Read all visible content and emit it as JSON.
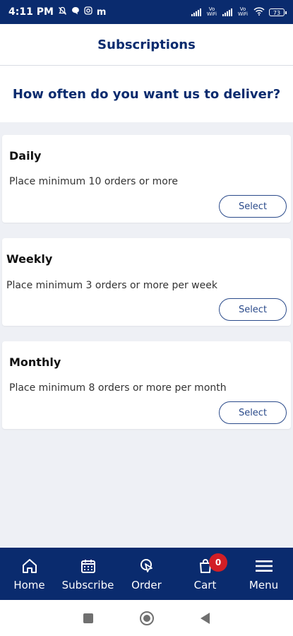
{
  "status_bar": {
    "time": "4:11 PM",
    "icons": [
      "mute-icon",
      "chat-bubble-icon",
      "instagram-icon",
      "messenger-m-icon"
    ],
    "left_extra": "m",
    "vo_wifi_1": "Vo WiFi",
    "vo_wifi_2": "Vo WiFi",
    "battery": "73"
  },
  "header": {
    "title": "Subscriptions"
  },
  "question": {
    "text": "How often do you want us to deliver?"
  },
  "cards": [
    {
      "title": "Daily",
      "description": "Place minimum 10 orders or more",
      "button": "Select"
    },
    {
      "title": "Weekly",
      "description": "Place minimum 3 orders or more per week",
      "button": "Select"
    },
    {
      "title": "Monthly",
      "description": "Place minimum 8 orders or more per month",
      "button": "Select"
    }
  ],
  "bottom_nav": {
    "items": [
      {
        "label": "Home",
        "icon": "home-icon"
      },
      {
        "label": "Subscribe",
        "icon": "calendar-icon"
      },
      {
        "label": "Order",
        "icon": "order-pointer-icon"
      },
      {
        "label": "Cart",
        "icon": "shopping-bag-icon",
        "badge": "0"
      },
      {
        "label": "Menu",
        "icon": "hamburger-menu-icon"
      }
    ]
  },
  "colors": {
    "primary": "#0a2b6e",
    "badge": "#d21f26",
    "background": "#eef0f5",
    "button_border": "#2a4a8a"
  }
}
